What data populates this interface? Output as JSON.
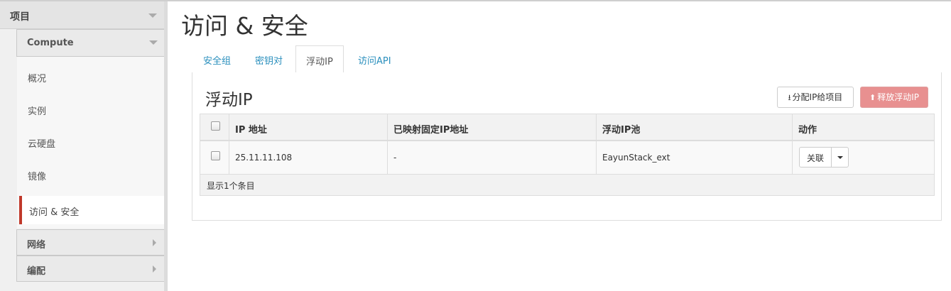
{
  "sidebar": {
    "project_label": "项目",
    "compute_label": "Compute",
    "items": [
      {
        "label": "概况"
      },
      {
        "label": "实例"
      },
      {
        "label": "云硬盘"
      },
      {
        "label": "镜像"
      },
      {
        "label": "访问 & 安全"
      }
    ],
    "network_label": "网络",
    "orchestration_label": "编配"
  },
  "page": {
    "title": "访问 & 安全"
  },
  "tabs": [
    {
      "label": "安全组"
    },
    {
      "label": "密钥对"
    },
    {
      "label": "浮动IP"
    },
    {
      "label": "访问API"
    }
  ],
  "panel": {
    "title": "浮动IP",
    "allocate_label": "分配IP给项目",
    "release_label": "释放浮动IP"
  },
  "table": {
    "columns": [
      "IP 地址",
      "已映射固定IP地址",
      "浮动IP池",
      "动作"
    ],
    "rows": [
      {
        "ip": "25.11.11.108",
        "fixed_ip": "-",
        "pool": "EayunStack_ext",
        "action": "关联"
      }
    ],
    "footer": "显示1个条目"
  },
  "colors": {
    "accent_red": "#c0392b",
    "link_blue": "#2a8fbd",
    "danger_button": "#e89090"
  }
}
